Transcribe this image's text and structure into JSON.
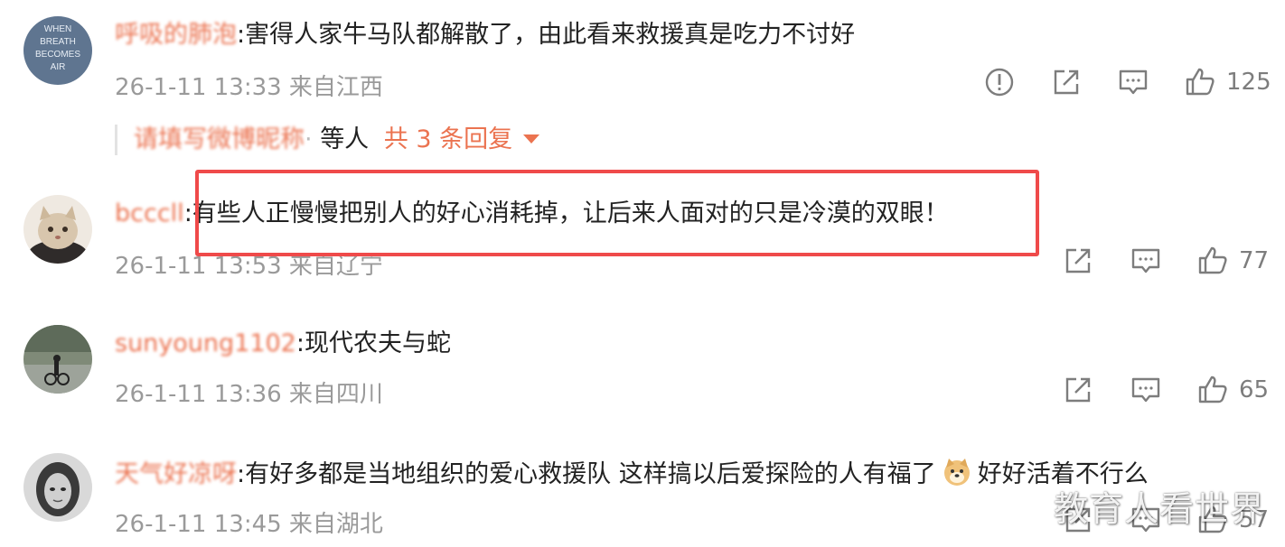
{
  "comments": [
    {
      "username": "呼吸的肺泡",
      "separator": ":",
      "text": "害得人家牛马队都解散了，由此看来救援真是吃力不讨好",
      "meta": "26-1-11 13:33 来自江西",
      "likes": "125",
      "avatar_text": [
        "WHEN",
        "BREATH",
        "BECOMES",
        "AIR"
      ],
      "replies": {
        "names": "请填写微博昵称",
        "dot": "·",
        "deng": "等人",
        "link": "共 3 条回复"
      }
    },
    {
      "username": "bcccll",
      "separator": ":",
      "text": "有些人正慢慢把别人的好心消耗掉，让后来人面对的只是冷漠的双眼！",
      "meta": "26-1-11 13:53 来自辽宁",
      "likes": "77"
    },
    {
      "username": "sunyoung1102",
      "separator": ":",
      "text": "现代农夫与蛇",
      "meta": "26-1-11 13:36 来自四川",
      "likes": "65"
    },
    {
      "username": "天气好凉呀",
      "separator": ":",
      "text_before_emoji": "有好多都是当地组织的爱心救援队 这样搞以后爱探险的人有福了",
      "text_after_emoji": "好好活着不行么",
      "emoji": "doge-emoji",
      "meta": "26-1-11 13:45 来自湖北",
      "likes": "57"
    }
  ],
  "watermark": "教育人看世界",
  "icons": {
    "report": "report-icon",
    "share": "share-icon",
    "comment": "comment-icon",
    "like": "like-icon"
  },
  "colors": {
    "username": "#eb7350",
    "text": "#222222",
    "meta": "#9a9a9a",
    "highlight": "#ef4a4a"
  }
}
